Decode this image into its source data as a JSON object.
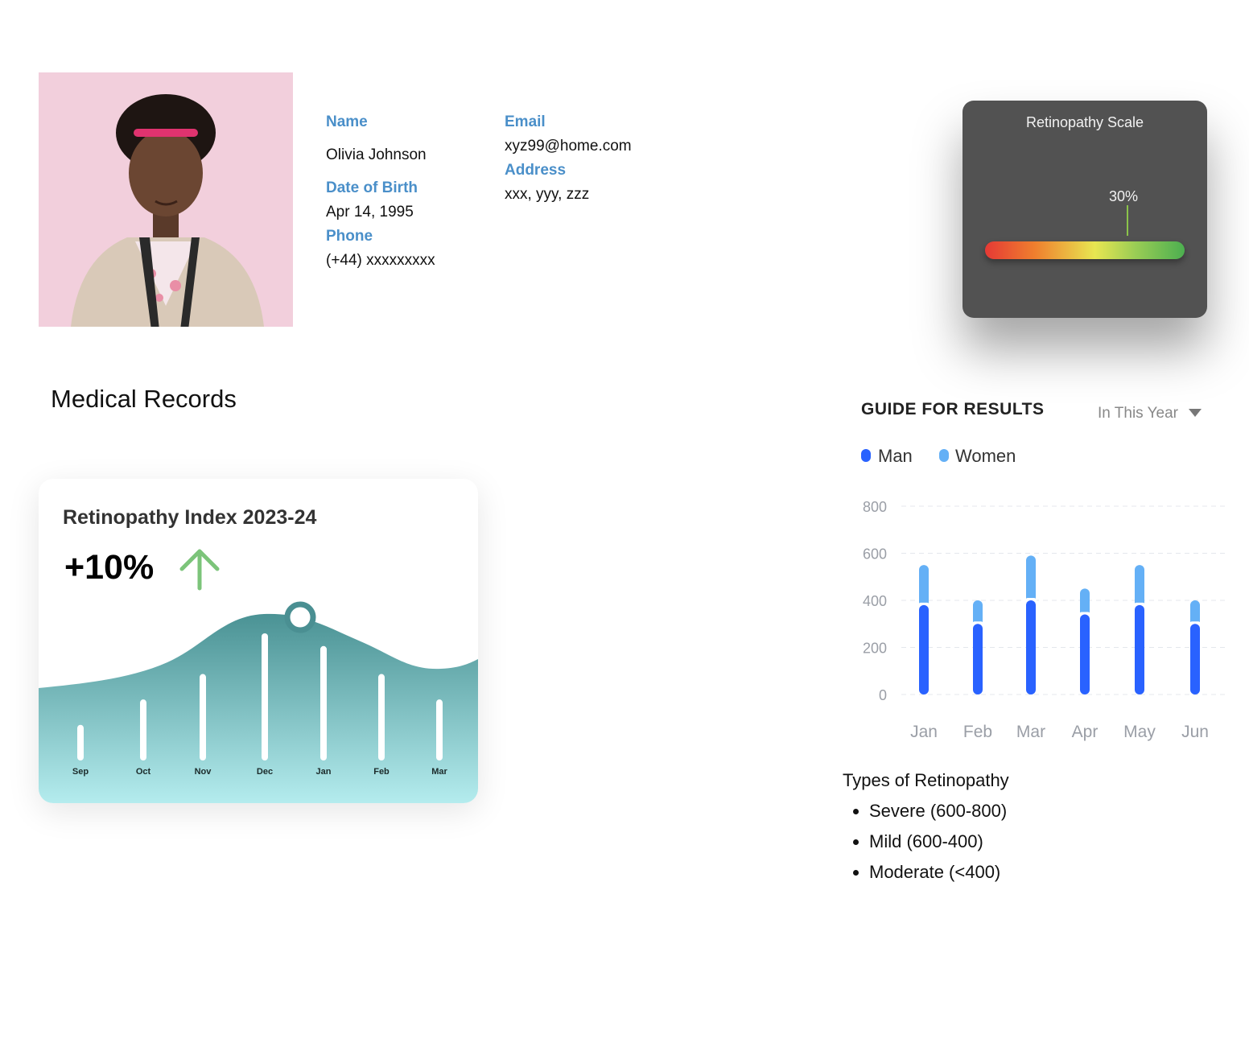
{
  "profile": {
    "name_label": "Name",
    "name": "Olivia Johnson",
    "dob_label": "Date of Birth",
    "dob": "Apr 14, 1995",
    "phone_label": "Phone",
    "phone": "(+44) xxxxxxxxx",
    "email_label": "Email",
    "email": "xyz99@home.com",
    "address_label": "Address",
    "address": "xxx, yyy, zzz"
  },
  "scale": {
    "title": "Retinopathy Scale",
    "value_label": "30%",
    "value": 0.3,
    "gradient": [
      "#e53935",
      "#ef7f2e",
      "#e8e651",
      "#9bcd55",
      "#4caf50"
    ]
  },
  "section_title": "Medical Records",
  "index_card": {
    "title": "Retinopathy Index 2023-24",
    "change": "+10%",
    "trend_icon": "arrow-up-icon",
    "trend_color": "#7cc47a",
    "wave_color_top": "#4a9294",
    "wave_color_bottom": "#b4ecee",
    "months": [
      "Sep",
      "Oct",
      "Nov",
      "Dec",
      "Jan",
      "Feb",
      "Mar"
    ],
    "bar_values": [
      0.28,
      0.48,
      0.68,
      1.0,
      0.9,
      0.68,
      0.48
    ],
    "selected_index": 4
  },
  "guide": {
    "title": "GUIDE FOR RESULTS",
    "period": "In This Year",
    "legend": [
      {
        "name": "Man",
        "color": "#2962ff"
      },
      {
        "name": "Women",
        "color": "#64b0f6"
      }
    ]
  },
  "chart_data": {
    "type": "bar",
    "stacked": true,
    "categories": [
      "Jan",
      "Feb",
      "Mar",
      "Apr",
      "May",
      "Jun"
    ],
    "series": [
      {
        "name": "Man",
        "values": [
          380,
          300,
          400,
          340,
          380,
          300
        ]
      },
      {
        "name": "Women",
        "values": [
          170,
          100,
          190,
          110,
          170,
          100
        ]
      }
    ],
    "yticks": [
      "0",
      "200",
      "400",
      "600",
      "800"
    ],
    "ylim": [
      0,
      800
    ],
    "grid": true,
    "legend_position": "top-left"
  },
  "types": {
    "title": "Types of Retinopathy",
    "items": [
      "Severe (600-800)",
      "Mild (600-400)",
      "Moderate (<400)"
    ]
  }
}
